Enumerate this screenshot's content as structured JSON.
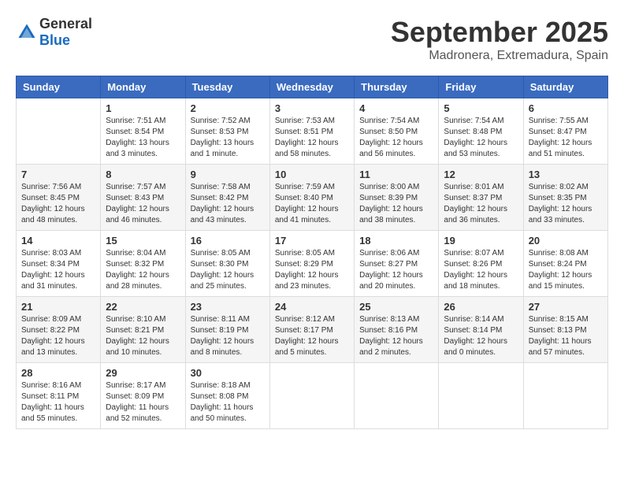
{
  "header": {
    "logo": {
      "general": "General",
      "blue": "Blue"
    },
    "title": "September 2025",
    "location": "Madronera, Extremadura, Spain"
  },
  "days_of_week": [
    "Sunday",
    "Monday",
    "Tuesday",
    "Wednesday",
    "Thursday",
    "Friday",
    "Saturday"
  ],
  "weeks": [
    [
      {
        "day": "",
        "info": ""
      },
      {
        "day": "1",
        "info": "Sunrise: 7:51 AM\nSunset: 8:54 PM\nDaylight: 13 hours\nand 3 minutes."
      },
      {
        "day": "2",
        "info": "Sunrise: 7:52 AM\nSunset: 8:53 PM\nDaylight: 13 hours\nand 1 minute."
      },
      {
        "day": "3",
        "info": "Sunrise: 7:53 AM\nSunset: 8:51 PM\nDaylight: 12 hours\nand 58 minutes."
      },
      {
        "day": "4",
        "info": "Sunrise: 7:54 AM\nSunset: 8:50 PM\nDaylight: 12 hours\nand 56 minutes."
      },
      {
        "day": "5",
        "info": "Sunrise: 7:54 AM\nSunset: 8:48 PM\nDaylight: 12 hours\nand 53 minutes."
      },
      {
        "day": "6",
        "info": "Sunrise: 7:55 AM\nSunset: 8:47 PM\nDaylight: 12 hours\nand 51 minutes."
      }
    ],
    [
      {
        "day": "7",
        "info": "Sunrise: 7:56 AM\nSunset: 8:45 PM\nDaylight: 12 hours\nand 48 minutes."
      },
      {
        "day": "8",
        "info": "Sunrise: 7:57 AM\nSunset: 8:43 PM\nDaylight: 12 hours\nand 46 minutes."
      },
      {
        "day": "9",
        "info": "Sunrise: 7:58 AM\nSunset: 8:42 PM\nDaylight: 12 hours\nand 43 minutes."
      },
      {
        "day": "10",
        "info": "Sunrise: 7:59 AM\nSunset: 8:40 PM\nDaylight: 12 hours\nand 41 minutes."
      },
      {
        "day": "11",
        "info": "Sunrise: 8:00 AM\nSunset: 8:39 PM\nDaylight: 12 hours\nand 38 minutes."
      },
      {
        "day": "12",
        "info": "Sunrise: 8:01 AM\nSunset: 8:37 PM\nDaylight: 12 hours\nand 36 minutes."
      },
      {
        "day": "13",
        "info": "Sunrise: 8:02 AM\nSunset: 8:35 PM\nDaylight: 12 hours\nand 33 minutes."
      }
    ],
    [
      {
        "day": "14",
        "info": "Sunrise: 8:03 AM\nSunset: 8:34 PM\nDaylight: 12 hours\nand 31 minutes."
      },
      {
        "day": "15",
        "info": "Sunrise: 8:04 AM\nSunset: 8:32 PM\nDaylight: 12 hours\nand 28 minutes."
      },
      {
        "day": "16",
        "info": "Sunrise: 8:05 AM\nSunset: 8:30 PM\nDaylight: 12 hours\nand 25 minutes."
      },
      {
        "day": "17",
        "info": "Sunrise: 8:05 AM\nSunset: 8:29 PM\nDaylight: 12 hours\nand 23 minutes."
      },
      {
        "day": "18",
        "info": "Sunrise: 8:06 AM\nSunset: 8:27 PM\nDaylight: 12 hours\nand 20 minutes."
      },
      {
        "day": "19",
        "info": "Sunrise: 8:07 AM\nSunset: 8:26 PM\nDaylight: 12 hours\nand 18 minutes."
      },
      {
        "day": "20",
        "info": "Sunrise: 8:08 AM\nSunset: 8:24 PM\nDaylight: 12 hours\nand 15 minutes."
      }
    ],
    [
      {
        "day": "21",
        "info": "Sunrise: 8:09 AM\nSunset: 8:22 PM\nDaylight: 12 hours\nand 13 minutes."
      },
      {
        "day": "22",
        "info": "Sunrise: 8:10 AM\nSunset: 8:21 PM\nDaylight: 12 hours\nand 10 minutes."
      },
      {
        "day": "23",
        "info": "Sunrise: 8:11 AM\nSunset: 8:19 PM\nDaylight: 12 hours\nand 8 minutes."
      },
      {
        "day": "24",
        "info": "Sunrise: 8:12 AM\nSunset: 8:17 PM\nDaylight: 12 hours\nand 5 minutes."
      },
      {
        "day": "25",
        "info": "Sunrise: 8:13 AM\nSunset: 8:16 PM\nDaylight: 12 hours\nand 2 minutes."
      },
      {
        "day": "26",
        "info": "Sunrise: 8:14 AM\nSunset: 8:14 PM\nDaylight: 12 hours\nand 0 minutes."
      },
      {
        "day": "27",
        "info": "Sunrise: 8:15 AM\nSunset: 8:13 PM\nDaylight: 11 hours\nand 57 minutes."
      }
    ],
    [
      {
        "day": "28",
        "info": "Sunrise: 8:16 AM\nSunset: 8:11 PM\nDaylight: 11 hours\nand 55 minutes."
      },
      {
        "day": "29",
        "info": "Sunrise: 8:17 AM\nSunset: 8:09 PM\nDaylight: 11 hours\nand 52 minutes."
      },
      {
        "day": "30",
        "info": "Sunrise: 8:18 AM\nSunset: 8:08 PM\nDaylight: 11 hours\nand 50 minutes."
      },
      {
        "day": "",
        "info": ""
      },
      {
        "day": "",
        "info": ""
      },
      {
        "day": "",
        "info": ""
      },
      {
        "day": "",
        "info": ""
      }
    ]
  ]
}
